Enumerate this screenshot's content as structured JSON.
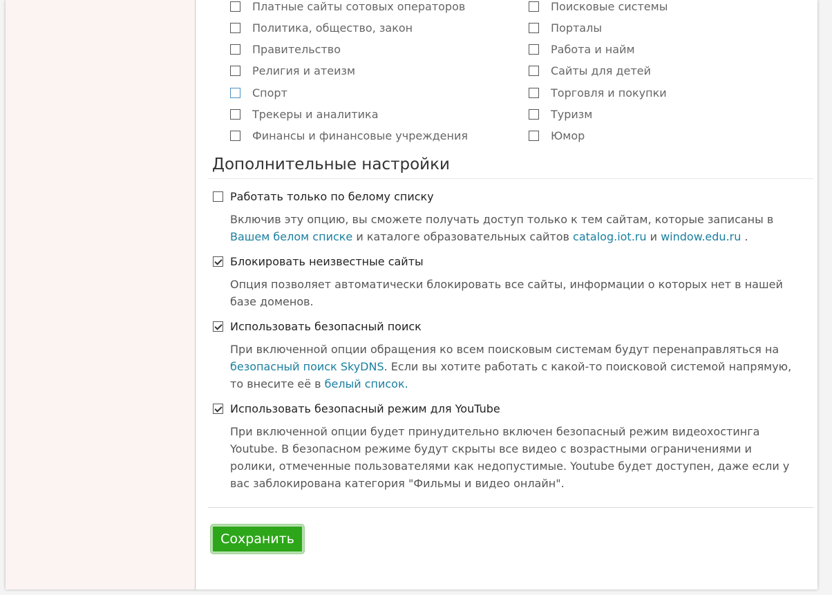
{
  "categories": {
    "left": [
      {
        "label": "Платные сайты сотовых операторов",
        "checked": false
      },
      {
        "label": "Политика, общество, закон",
        "checked": false
      },
      {
        "label": "Правительство",
        "checked": false
      },
      {
        "label": "Религия и атеизм",
        "checked": false
      },
      {
        "label": "Спорт",
        "checked": false
      },
      {
        "label": "Трекеры и аналитика",
        "checked": false
      },
      {
        "label": "Финансы и финансовые учреждения",
        "checked": false
      }
    ],
    "right": [
      {
        "label": "Поисковые системы",
        "checked": false
      },
      {
        "label": "Порталы",
        "checked": false
      },
      {
        "label": "Работа и найм",
        "checked": false
      },
      {
        "label": "Сайты для детей",
        "checked": false
      },
      {
        "label": "Торговля и покупки",
        "checked": false
      },
      {
        "label": "Туризм",
        "checked": false
      },
      {
        "label": "Юмор",
        "checked": false
      }
    ]
  },
  "additional": {
    "title": "Дополнительные настройки",
    "whitelist_only": {
      "label": "Работать только по белому списку",
      "checked": false,
      "desc_1": "Включив эту опцию, вы сможете получать доступ только к тем сайтам, которые записаны в ",
      "link_whitelist": "Вашем белом списке",
      "desc_2": " и каталоге образовательных сайтов ",
      "link_catalog": "catalog.iot.ru",
      "desc_3": " и ",
      "link_window": "window.edu.ru",
      "desc_4": " ."
    },
    "block_unknown": {
      "label": "Блокировать неизвестные сайты",
      "checked": true,
      "desc": "Опция позволяет автоматически блокировать все сайты, информации о которых нет в нашей базе доменов."
    },
    "safe_search": {
      "label": "Использовать безопасный поиск",
      "checked": true,
      "desc_1": "При включенной опции обращения ко всем поисковым системам будут перенаправляться на ",
      "link_safe": "безопасный поиск SkyDNS",
      "desc_2": ". Если вы хотите работать с какой-то поисковой системой напрямую, то внесите её в ",
      "link_white": "белый список."
    },
    "youtube": {
      "label": "Использовать безопасный режим для YouTube",
      "checked": true,
      "desc": "При включенной опции будет принудительно включен безопасный режим видеохостинга Youtube. В безопасном режиме будут скрыты все видео с возрастными ограничениями и ролики, отмеченные пользователями как недопустимые. Youtube будет доступен, даже если у вас заблокирована категория \"Фильмы и видео онлайн\"."
    }
  },
  "save_label": "Сохранить",
  "colors": {
    "link": "#1a7fa0",
    "button": "#2ea61a",
    "sidebar": "#fbf4f3"
  }
}
